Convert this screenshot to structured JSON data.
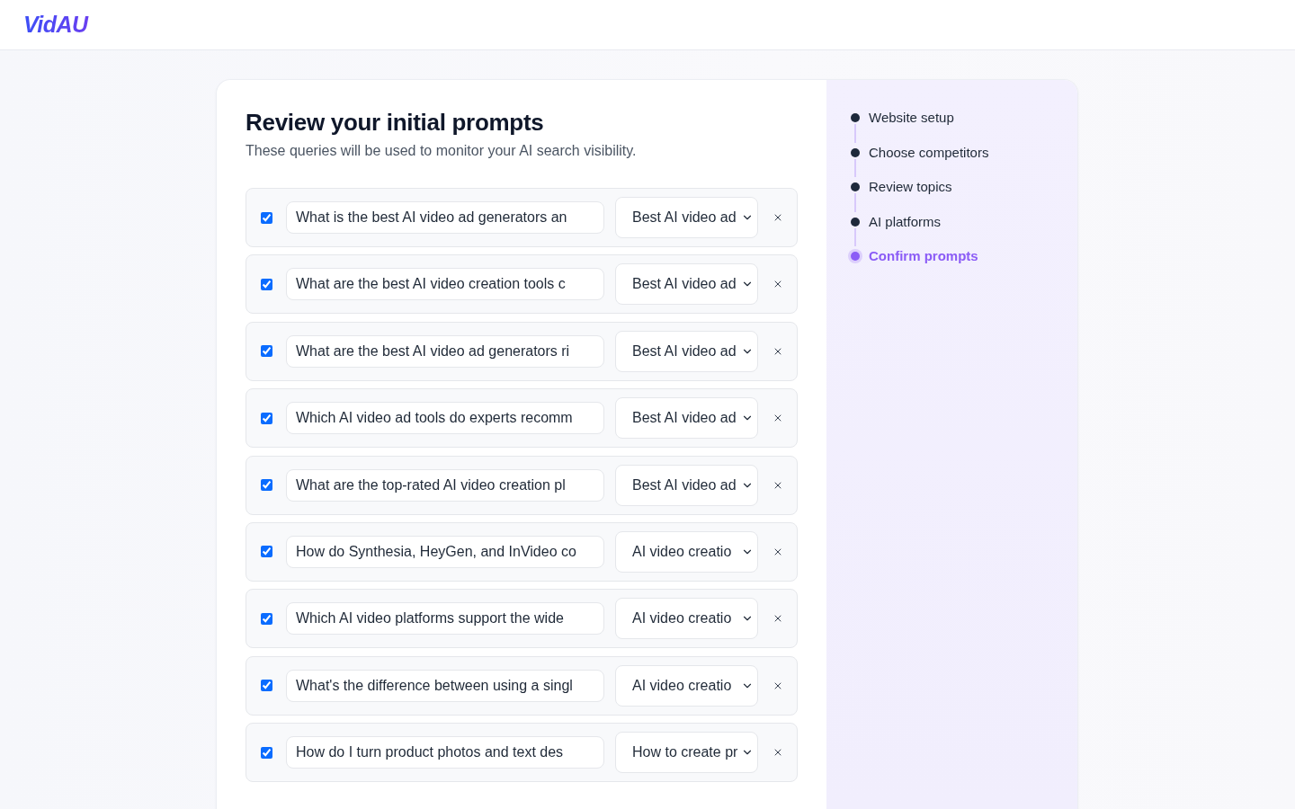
{
  "header": {
    "logo": "VidAU"
  },
  "title": "Review your initial prompts",
  "subtitle": "These queries will be used to monitor your AI search visibility.",
  "prompts": [
    {
      "checked": true,
      "prompt": "What is the best AI video ad generators an",
      "topic": "Best AI video ad"
    },
    {
      "checked": true,
      "prompt": "What are the best AI video creation tools c",
      "topic": "Best AI video ad"
    },
    {
      "checked": true,
      "prompt": "What are the best AI video ad generators ri",
      "topic": "Best AI video ad"
    },
    {
      "checked": true,
      "prompt": "Which AI video ad tools do experts recomm",
      "topic": "Best AI video ad"
    },
    {
      "checked": true,
      "prompt": "What are the top-rated AI video creation pl",
      "topic": "Best AI video ad"
    },
    {
      "checked": true,
      "prompt": "How do Synthesia, HeyGen, and InVideo co",
      "topic": "AI video creatio"
    },
    {
      "checked": true,
      "prompt": "Which AI video platforms support the wide",
      "topic": "AI video creatio"
    },
    {
      "checked": true,
      "prompt": "What's the difference between using a singl",
      "topic": "AI video creatio"
    },
    {
      "checked": true,
      "prompt": "How do I turn product photos and text des",
      "topic": "How to create pr"
    }
  ],
  "steps": [
    {
      "label": "Website setup",
      "selected": false
    },
    {
      "label": "Choose competitors",
      "selected": false
    },
    {
      "label": "Review topics",
      "selected": false
    },
    {
      "label": "AI platforms",
      "selected": false
    },
    {
      "label": "Confirm prompts",
      "selected": true
    }
  ]
}
